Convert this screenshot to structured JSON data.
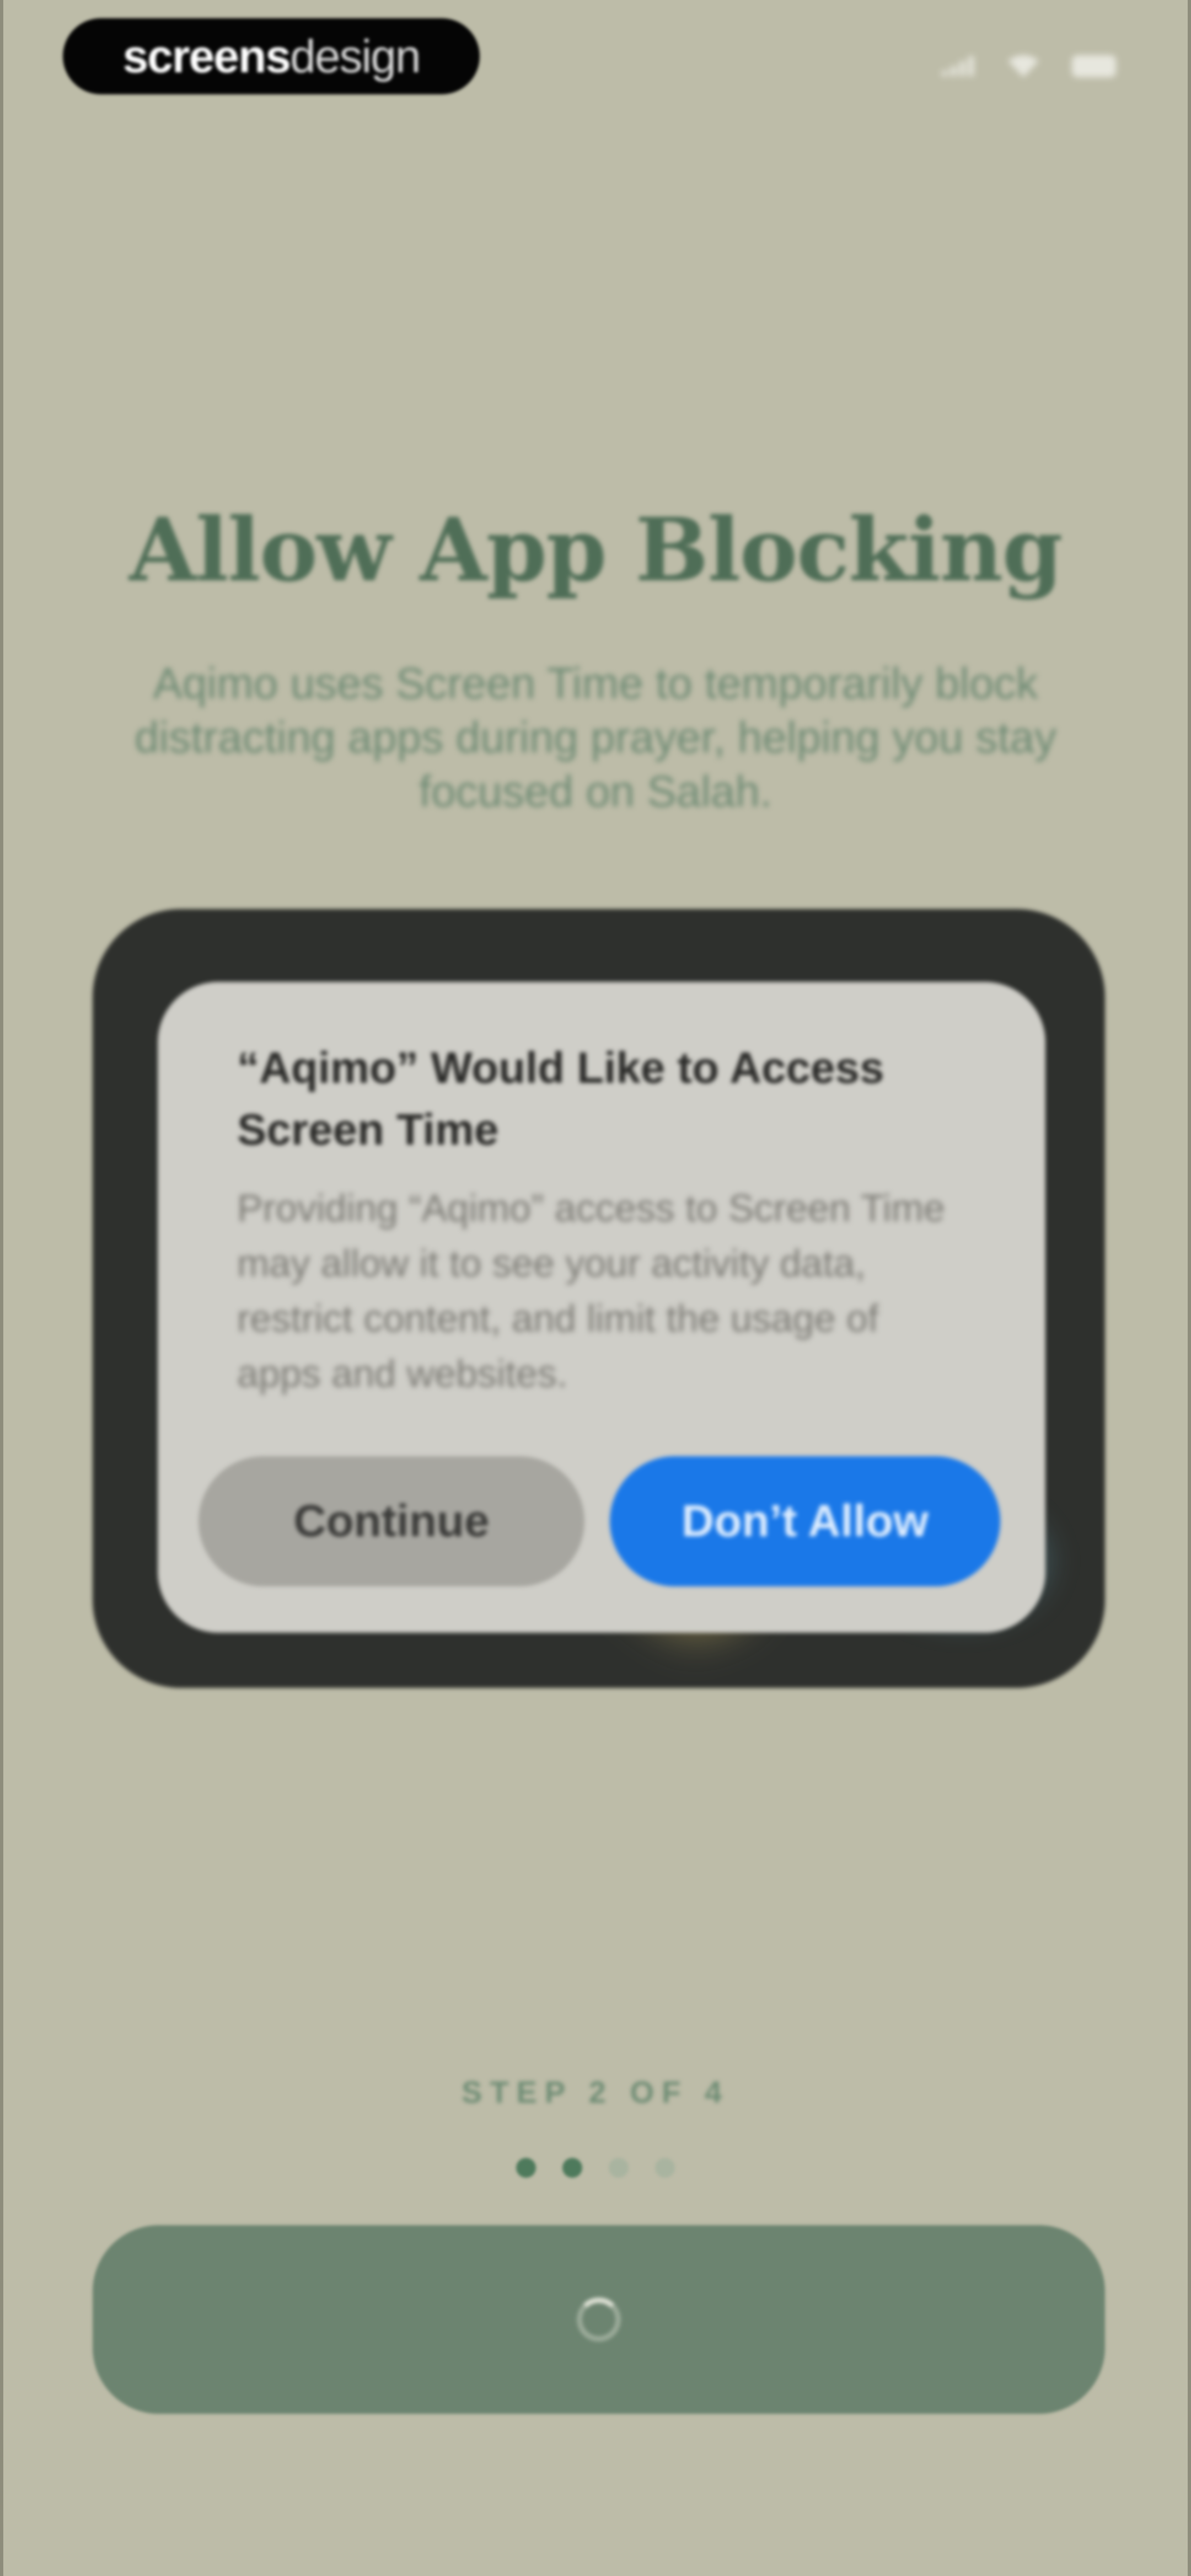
{
  "watermark": {
    "strong": "screens",
    "light": "design"
  },
  "status_bar": {
    "icons": [
      "signal-icon",
      "wifi-icon",
      "battery-icon"
    ]
  },
  "onboarding": {
    "title": "Allow App Blocking",
    "subtitle": "Aqimo uses Screen Time to temporarily block distracting apps during prayer, helping you stay focused on Salah."
  },
  "permission_dialog": {
    "title": "“Aqimo” Would Like to Access Screen Time",
    "body": "Providing “Aqimo” access to Screen Time may allow it to see your activity data, restrict content, and limit the usage of apps and websites.",
    "continue_label": "Continue",
    "dont_allow_label": "Don’t Allow"
  },
  "progress": {
    "step_label": "STEP 2 OF 4",
    "current_step": 2,
    "total_steps": 4
  },
  "cta": {
    "state": "loading",
    "icon": "spinner-icon"
  },
  "colors": {
    "background": "#bdbca8",
    "title": "#4f6e57",
    "accent_blue": "#1a78e8",
    "cta": "#6c8470"
  }
}
